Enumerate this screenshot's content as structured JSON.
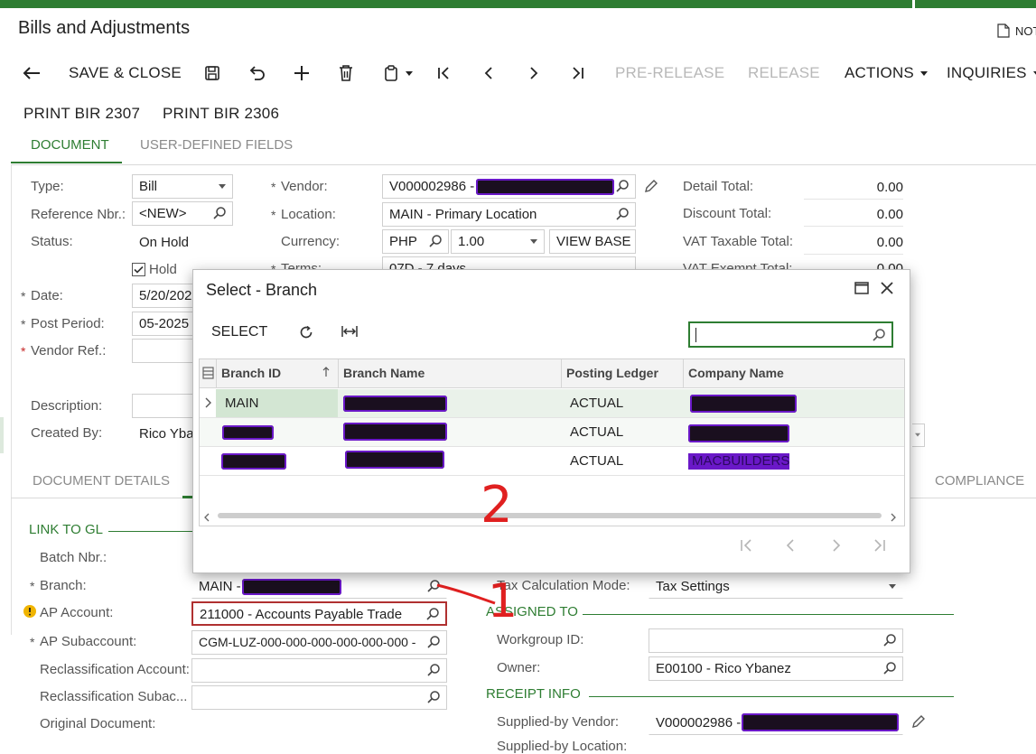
{
  "app": {
    "title": "Bills and Adjustments",
    "notes_label": "NOT"
  },
  "toolbar": {
    "save_close": "SAVE & CLOSE",
    "pre_release": "PRE-RELEASE",
    "release": "RELEASE",
    "actions": "ACTIONS",
    "inquiries": "INQUIRIES",
    "print_2307": "PRINT BIR 2307",
    "print_2306": "PRINT BIR 2306"
  },
  "tabs": {
    "document": "DOCUMENT",
    "user_defined": "USER-DEFINED FIELDS"
  },
  "form": {
    "type_label": "Type:",
    "type_value": "Bill",
    "ref_label": "Reference Nbr.:",
    "ref_value": "<NEW>",
    "status_label": "Status:",
    "status_value": "On Hold",
    "hold_label": "Hold",
    "date_label": "Date:",
    "date_value": "5/20/2025",
    "period_label": "Post Period:",
    "period_value": "05-2025",
    "vendor_ref_label": "Vendor Ref.:",
    "description_label": "Description:",
    "created_by_label": "Created By:",
    "created_by_value": "Rico Yba",
    "vendor_label": "Vendor:",
    "vendor_value": "V000002986 -",
    "location_label": "Location:",
    "location_value": "MAIN - Primary Location",
    "currency_label": "Currency:",
    "currency_value": "PHP",
    "rate_value": "1.00",
    "view_base": "VIEW BASE",
    "terms_label": "Terms:",
    "terms_value": "07D - 7 days",
    "detail_total_label": "Detail Total:",
    "detail_total": "0.00",
    "discount_total_label": "Discount Total:",
    "discount_total": "0.00",
    "vat_taxable_label": "VAT Taxable Total:",
    "vat_taxable": "0.00",
    "vat_exempt_label": "VAT Exempt Total:",
    "vat_exempt": "0.00"
  },
  "lower_tabs": {
    "details": "DOCUMENT DETAILS",
    "compliance": "COMPLIANCE"
  },
  "gl": {
    "section": "LINK TO GL",
    "batch_label": "Batch Nbr.:",
    "branch_label": "Branch:",
    "branch_value": "MAIN -",
    "ap_account_label": "AP Account:",
    "ap_account_value": "211000 - Accounts Payable Trade",
    "ap_sub_label": "AP Subaccount:",
    "ap_sub_value": "CGM-LUZ-000-000-000-000-000-000 -",
    "reclass_label": "Reclassification Account:",
    "reclass_sub_label": "Reclassification Subac...",
    "orig_doc_label": "Original Document:"
  },
  "right": {
    "tax_mode_label": "Tax Calculation Mode:",
    "tax_mode_value": "Tax Settings",
    "assigned_section": "ASSIGNED TO",
    "workgroup_label": "Workgroup ID:",
    "owner_label": "Owner:",
    "owner_value": "E00100 - Rico Ybanez",
    "receipt_section": "RECEIPT INFO",
    "supplied_label": "Supplied-by Vendor:",
    "supplied_value": "V000002986 -",
    "supplied_loc_label": "Supplied-by Location:"
  },
  "dialog": {
    "title": "Select - Branch",
    "select_btn": "SELECT",
    "search_value": "",
    "columns": [
      "Branch ID",
      "Branch Name",
      "Posting Ledger",
      "Company Name"
    ],
    "rows": [
      {
        "id": "MAIN",
        "ledger": "ACTUAL",
        "company": ""
      },
      {
        "id": "",
        "ledger": "ACTUAL",
        "company": ""
      },
      {
        "id": "",
        "ledger": "ACTUAL",
        "company": "MACBUILDERS"
      }
    ]
  },
  "annotations": {
    "one": "1",
    "two": "2"
  }
}
